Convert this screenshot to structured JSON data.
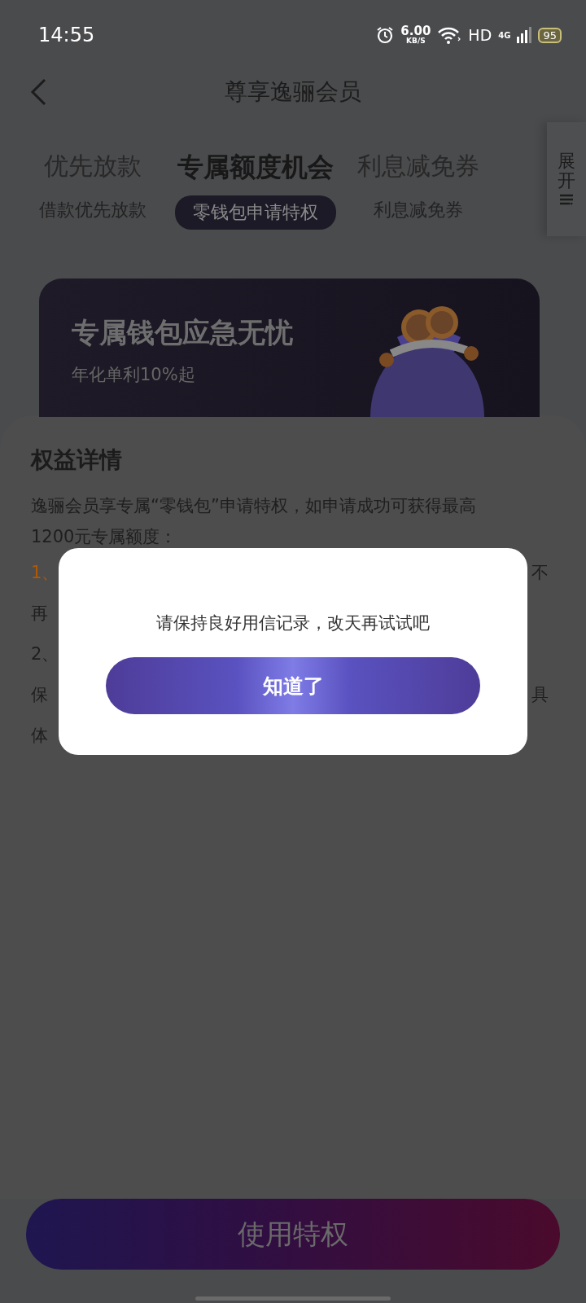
{
  "status_bar": {
    "time": "14:55",
    "speed_value": "6.00",
    "speed_unit": "KB/S",
    "network_label": "HD",
    "signal_label": "4G",
    "battery": "95"
  },
  "header": {
    "title": "尊享逸骊会员"
  },
  "tabs": [
    {
      "label": "优先放款",
      "sublabel": "借款优先放款",
      "selected": false
    },
    {
      "label": "专属额度机会",
      "sublabel": "零钱包申请特权",
      "selected": true
    },
    {
      "label": "利息减免券",
      "sublabel": "利息减免券",
      "selected": false
    }
  ],
  "expand": {
    "label": "展开"
  },
  "banner": {
    "title": "专属钱包应急无忧",
    "subtitle": "年化单利10%起"
  },
  "details": {
    "title": "权益详情",
    "intro": "逸骊会员享专属“零钱包”申请特权，如申请成功可获得最高1200元专属额度：",
    "lines": [
      {
        "left": "1、",
        "right": "不",
        "highlighted": true
      },
      {
        "left": "再",
        "highlighted": false
      },
      {
        "left": "2、",
        "highlighted": false
      },
      {
        "left": "保",
        "right": "具",
        "highlighted": false
      },
      {
        "left": "体",
        "highlighted": false
      }
    ]
  },
  "dialog": {
    "message": "请保持良好用信记录，改天再试试吧",
    "button": "知道了"
  },
  "bottom_button": {
    "label": "使用特权"
  }
}
